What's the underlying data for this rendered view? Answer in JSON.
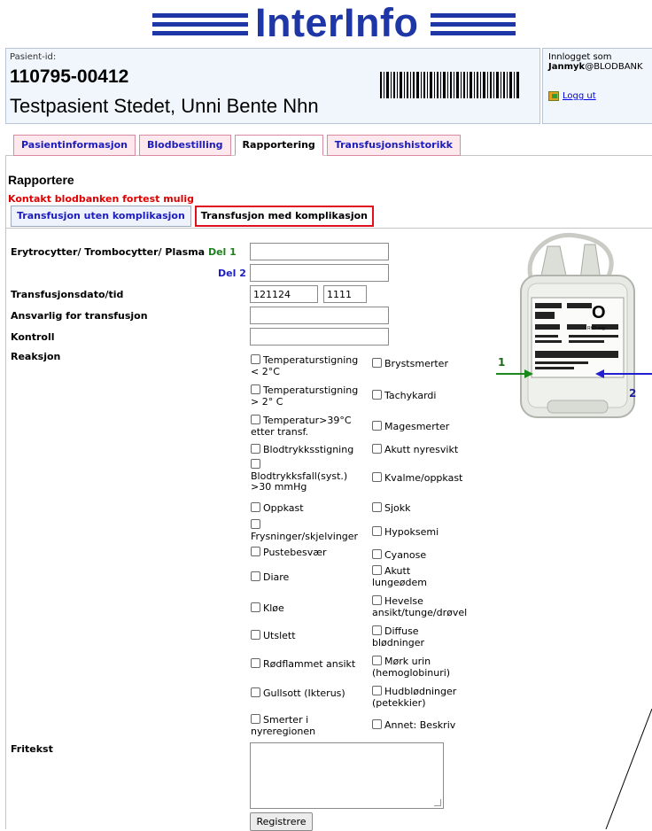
{
  "app": {
    "logo_text": "InterInfo"
  },
  "patient": {
    "id_label": "Pasient-id:",
    "id": "110795-00412",
    "name": "Testpasient Stedet, Unni Bente Nhn"
  },
  "login": {
    "label": "Innlogget som",
    "user": "Janmyk",
    "domain": "@BLODBANK",
    "logout": "Logg ut"
  },
  "main_tabs": [
    {
      "label": "Pasientinformasjon",
      "active": false
    },
    {
      "label": "Blodbestilling",
      "active": false
    },
    {
      "label": "Rapportering",
      "active": true
    },
    {
      "label": "Transfusjonshistorikk",
      "active": false
    }
  ],
  "section": {
    "title": "Rapportere",
    "warning": "Kontakt blodbanken fortest mulig"
  },
  "sub_tabs": [
    {
      "label": "Transfusjon uten komplikasjon",
      "active": false
    },
    {
      "label": "Transfusjon med komplikasjon",
      "active": true
    }
  ],
  "form": {
    "product_label": "Erytrocytter/ Trombocytter/ Plasma",
    "part1_label": "Del 1",
    "part2_label": "Del 2",
    "part1_value": "",
    "part2_value": "",
    "datetime_label": "Transfusjonsdato/tid",
    "date_value": "121124",
    "time_value": "1111",
    "responsible_label": "Ansvarlig for transfusjon",
    "responsible_value": "",
    "control_label": "Kontroll",
    "control_value": "",
    "reaction_label": "Reaksjon",
    "freetext_label": "Fritekst",
    "freetext_value": "",
    "submit_label": "Registrere"
  },
  "reactions_left": [
    {
      "line1": "Temperaturstigning",
      "line2": "< 2°C",
      "checked": false
    },
    {
      "line1": "Temperaturstigning",
      "line2": "> 2° C",
      "checked": false
    },
    {
      "line1": "Temperatur>39°C",
      "line2": "etter transf.",
      "checked": false
    },
    {
      "line1": "Blodtrykksstigning",
      "line2": "",
      "checked": false
    },
    {
      "line1": "",
      "line2": "Blodtrykksfall(syst.)",
      "line3": ">30 mmHg",
      "checked": false
    },
    {
      "line1": "Oppkast",
      "line2": "",
      "checked": false
    },
    {
      "line1": "",
      "line2": "Frysninger/skjelvinger",
      "checked": false
    },
    {
      "line1": "Pustebesvær",
      "line2": "",
      "checked": false
    },
    {
      "line1": "Diare",
      "line2": "",
      "checked": false
    },
    {
      "line1": "Kløe",
      "line2": "",
      "checked": false
    },
    {
      "line1": "Utslett",
      "line2": "",
      "checked": false
    },
    {
      "line1": "Rødflammet ansikt",
      "line2": "",
      "checked": false
    },
    {
      "line1": "Gullsott (Ikterus)",
      "line2": "",
      "checked": false
    },
    {
      "line1": "Smerter i",
      "line2": "nyreregionen",
      "checked": false
    }
  ],
  "reactions_right": [
    {
      "line1": "Brystsmerter",
      "line2": "",
      "checked": false
    },
    {
      "line1": "Tachykardi",
      "line2": "",
      "checked": false
    },
    {
      "line1": "Magesmerter",
      "line2": "",
      "checked": false
    },
    {
      "line1": "Akutt nyresvikt",
      "line2": "",
      "checked": false
    },
    {
      "line1": "Kvalme/oppkast",
      "line2": "",
      "checked": false
    },
    {
      "line1": "Sjokk",
      "line2": "",
      "checked": false
    },
    {
      "line1": "Hypoksemi",
      "line2": "",
      "checked": false
    },
    {
      "line1": "Cyanose",
      "line2": "",
      "checked": false
    },
    {
      "line1": "Akutt",
      "line2": "lungeødem",
      "checked": false
    },
    {
      "line1": "Hevelse",
      "line2": "ansikt/tunge/drøvel",
      "checked": false
    },
    {
      "line1": "Diffuse",
      "line2": "blødninger",
      "checked": false
    },
    {
      "line1": "Mørk urin",
      "line2": "(hemoglobinuri)",
      "checked": false
    },
    {
      "line1": "Hudblødninger",
      "line2": "(petekkier)",
      "checked": false
    },
    {
      "line1": "Annet: Beskriv",
      "line2": "",
      "checked": false
    }
  ],
  "bag_image": {
    "blood_group": "O",
    "rhesus": "RhD neg",
    "arrow1_label": "1",
    "arrow2_label": "2"
  },
  "colors": {
    "logo_blue": "#1f37a6",
    "tab_pink": "#fde8ee",
    "warning_red": "#e00000",
    "highlight_red": "#e01020"
  }
}
